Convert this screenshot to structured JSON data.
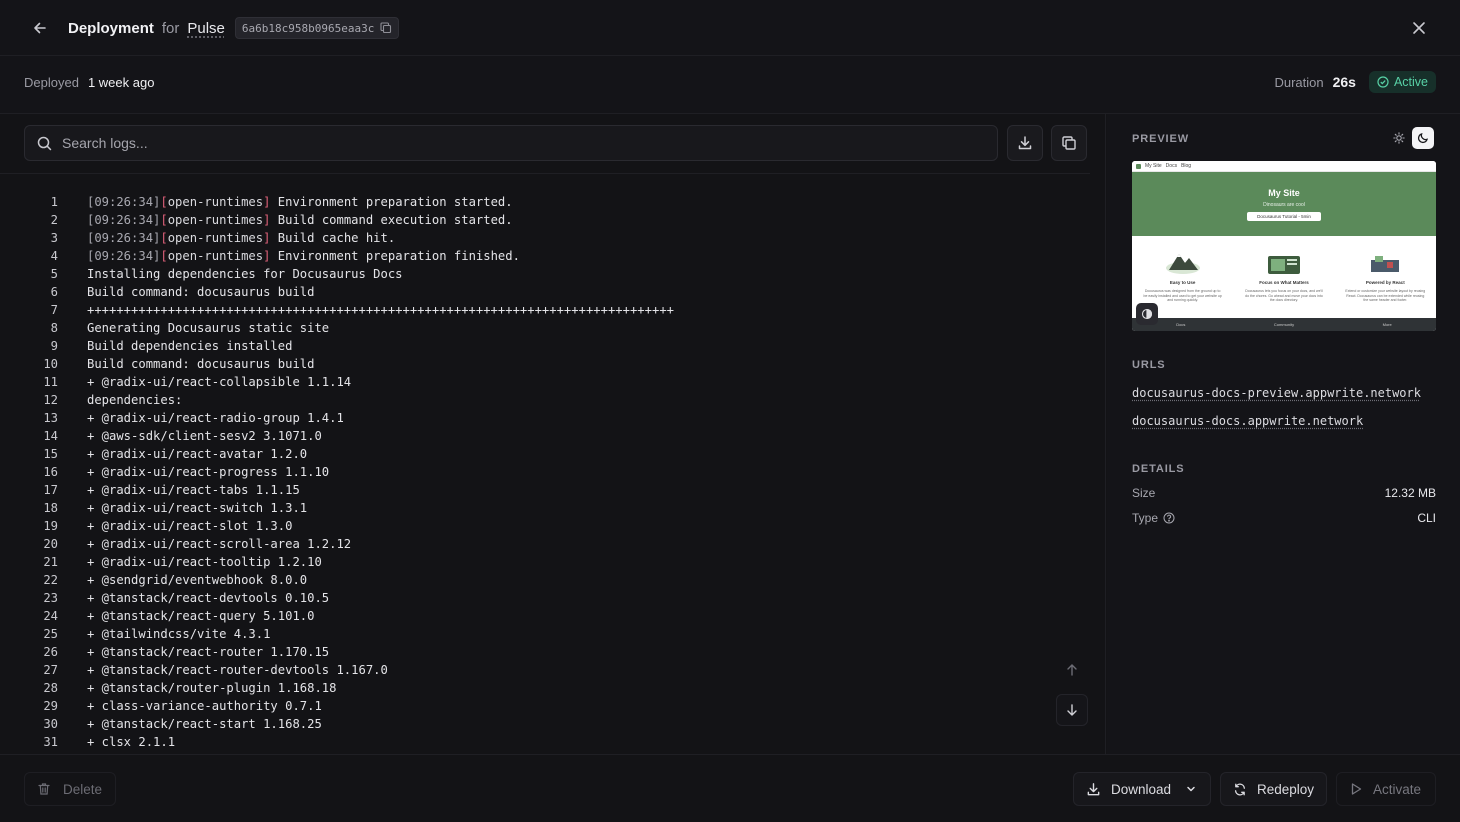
{
  "header": {
    "title": "Deployment",
    "for_label": "for",
    "project": "Pulse",
    "deployment_id": "6a6b18c958b0965eaa3c"
  },
  "meta": {
    "deployed_label": "Deployed",
    "deployed_value": "1 week ago",
    "duration_label": "Duration",
    "duration_value": "26s",
    "status": "Active"
  },
  "logs": {
    "search_placeholder": "Search logs...",
    "lines": [
      {
        "n": "1",
        "ts": "[09:26:34]",
        "tag": "open-runtimes",
        "msg": " Environment preparation started."
      },
      {
        "n": "2",
        "ts": "[09:26:34]",
        "tag": "open-runtimes",
        "msg": " Build command execution started."
      },
      {
        "n": "3",
        "ts": "[09:26:34]",
        "tag": "open-runtimes",
        "msg": " Build cache hit."
      },
      {
        "n": "4",
        "ts": "[09:26:34]",
        "tag": "open-runtimes",
        "msg": " Environment preparation finished."
      },
      {
        "n": "5",
        "text": "Installing dependencies for Docusaurus Docs"
      },
      {
        "n": "6",
        "text": "Build command: docusaurus build"
      },
      {
        "n": "7",
        "text": "++++++++++++++++++++++++++++++++++++++++++++++++++++++++++++++++++++++++++++++++"
      },
      {
        "n": "8",
        "text": "Generating Docusaurus static site"
      },
      {
        "n": "9",
        "text": "Build dependencies installed"
      },
      {
        "n": "10",
        "text": "Build command: docusaurus build"
      },
      {
        "n": "11",
        "text": "+ @radix-ui/react-collapsible 1.1.14"
      },
      {
        "n": "12",
        "text": "dependencies:"
      },
      {
        "n": "13",
        "text": "+ @radix-ui/react-radio-group 1.4.1"
      },
      {
        "n": "14",
        "text": "+ @aws-sdk/client-sesv2 3.1071.0"
      },
      {
        "n": "15",
        "text": "+ @radix-ui/react-avatar 1.2.0"
      },
      {
        "n": "16",
        "text": "+ @radix-ui/react-progress 1.1.10"
      },
      {
        "n": "17",
        "text": "+ @radix-ui/react-tabs 1.1.15"
      },
      {
        "n": "18",
        "text": "+ @radix-ui/react-switch 1.3.1"
      },
      {
        "n": "19",
        "text": "+ @radix-ui/react-slot 1.3.0"
      },
      {
        "n": "20",
        "text": "+ @radix-ui/react-scroll-area 1.2.12"
      },
      {
        "n": "21",
        "text": "+ @radix-ui/react-tooltip 1.2.10"
      },
      {
        "n": "22",
        "text": "+ @sendgrid/eventwebhook 8.0.0"
      },
      {
        "n": "23",
        "text": "+ @tanstack/react-devtools 0.10.5"
      },
      {
        "n": "24",
        "text": "+ @tanstack/react-query 5.101.0"
      },
      {
        "n": "25",
        "text": "+ @tailwindcss/vite 4.3.1"
      },
      {
        "n": "26",
        "text": "+ @tanstack/react-router 1.170.15"
      },
      {
        "n": "27",
        "text": "+ @tanstack/react-router-devtools 1.167.0"
      },
      {
        "n": "28",
        "text": "+ @tanstack/router-plugin 1.168.18"
      },
      {
        "n": "29",
        "text": "+ class-variance-authority 0.7.1"
      },
      {
        "n": "30",
        "text": "+ @tanstack/react-start 1.168.25"
      },
      {
        "n": "31",
        "text": "+ clsx 2.1.1"
      }
    ]
  },
  "side": {
    "preview_label": "PREVIEW",
    "preview_site": {
      "nav_brand": "My Site",
      "nav_link": "Docs",
      "nav_link2": "Blog",
      "hero_title": "My Site",
      "hero_subtitle": "Dinosaurs are cool",
      "hero_button": "Docusaurus Tutorial - 5min",
      "features": [
        {
          "title": "Easy to Use",
          "text": "Docusaurus was designed from the ground up to be easily installed and used to get your website up and running quickly."
        },
        {
          "title": "Focus on What Matters",
          "text": "Docusaurus lets you focus on your docs, and we'll do the chores. Go ahead and move your docs into the docs directory."
        },
        {
          "title": "Powered by React",
          "text": "Extend or customize your website layout by reusing React. Docusaurus can be extended while reusing the same header and footer."
        }
      ],
      "footer_cols": [
        "Docs",
        "Community",
        "More"
      ]
    },
    "urls_label": "URLS",
    "urls": [
      "docusaurus-docs-preview.appwrite.network",
      "docusaurus-docs.appwrite.network"
    ],
    "details_label": "DETAILS",
    "size_label": "Size",
    "size_value": "12.32 MB",
    "type_label": "Type",
    "type_value": "CLI"
  },
  "footer": {
    "delete_label": "Delete",
    "download_label": "Download",
    "redeploy_label": "Redeploy",
    "activate_label": "Activate"
  },
  "colors": {
    "background": "#131316",
    "accent_active": "#58d1a6",
    "log_bracket": "#e0617a",
    "preview_hero": "#5b8a5a"
  }
}
